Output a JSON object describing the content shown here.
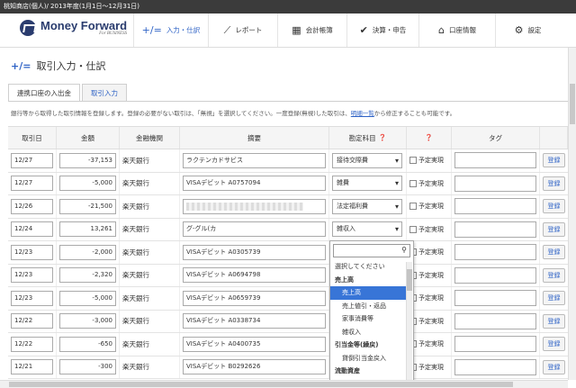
{
  "window": {
    "title": "桃知商店(個人)/  2013年度(1月1日～12月31日)"
  },
  "brand": {
    "name": "Money Forward",
    "sub": "For BUSINESS"
  },
  "nav": [
    {
      "label": "入力・仕訳",
      "icon": "+/="
    },
    {
      "label": "レポート",
      "icon": "⟋"
    },
    {
      "label": "会計帳簿",
      "icon": "▦"
    },
    {
      "label": "決算・申告",
      "icon": "✔"
    },
    {
      "label": "口座情報",
      "icon": "⌂"
    },
    {
      "label": "設定",
      "icon": "⚙"
    }
  ],
  "page": {
    "title": "取引入力・仕訳"
  },
  "tabs": [
    "連携口座の入出金",
    "取引入力"
  ],
  "notice": {
    "text": "銀行等から取得した取引情報を登録します。登録の必要がない取引は、「無視」を選択してください。一度登録(無視)した取引は、",
    "link": "明細一覧",
    "after": "から修正することも可能です。"
  },
  "table": {
    "headers": [
      "取引日",
      "金額",
      "金融機関",
      "摘要",
      "勘定科目",
      "",
      "タグ"
    ],
    "plan_label": "予定実現",
    "register_label": "登録",
    "rows": [
      {
        "date": "12/27",
        "amount": "-37,153",
        "bank": "楽天銀行",
        "desc": "ラクテンカドサビス",
        "account": "接待交際費"
      },
      {
        "date": "12/27",
        "amount": "-5,000",
        "bank": "楽天銀行",
        "desc": "VISAデビット A0757094",
        "account": "雑費"
      },
      {
        "date": "12/26",
        "amount": "-21,500",
        "bank": "楽天銀行",
        "desc": "",
        "account": "法定福利費"
      },
      {
        "date": "12/24",
        "amount": "13,261",
        "bank": "楽天銀行",
        "desc": "グ-グル(カ",
        "account": "雑収入"
      },
      {
        "date": "12/23",
        "amount": "-2,000",
        "bank": "楽天銀行",
        "desc": "VISAデビット A0305739",
        "account": ""
      },
      {
        "date": "12/23",
        "amount": "-2,320",
        "bank": "楽天銀行",
        "desc": "VISAデビット A0694798",
        "account": ""
      },
      {
        "date": "12/23",
        "amount": "-5,000",
        "bank": "楽天銀行",
        "desc": "VISAデビット A0659739",
        "account": ""
      },
      {
        "date": "12/22",
        "amount": "-3,000",
        "bank": "楽天銀行",
        "desc": "VISAデビット A0338734",
        "account": ""
      },
      {
        "date": "12/22",
        "amount": "-650",
        "bank": "楽天銀行",
        "desc": "VISAデビット A0400735",
        "account": ""
      },
      {
        "date": "12/21",
        "amount": "-300",
        "bank": "楽天銀行",
        "desc": "VISAデビット B0292626",
        "account": ""
      }
    ]
  },
  "dropdown": {
    "items": [
      {
        "label": "選択してください",
        "kind": "plain"
      },
      {
        "label": "売上高",
        "kind": "group"
      },
      {
        "label": "売上高",
        "kind": "selected"
      },
      {
        "label": "売上値引・返品",
        "kind": "sub"
      },
      {
        "label": "家事消費等",
        "kind": "sub"
      },
      {
        "label": "雑収入",
        "kind": "sub"
      },
      {
        "label": "引当金等(繰戻)",
        "kind": "group"
      },
      {
        "label": "貸倒引当金戻入",
        "kind": "sub"
      },
      {
        "label": "流動資産",
        "kind": "group"
      }
    ]
  }
}
